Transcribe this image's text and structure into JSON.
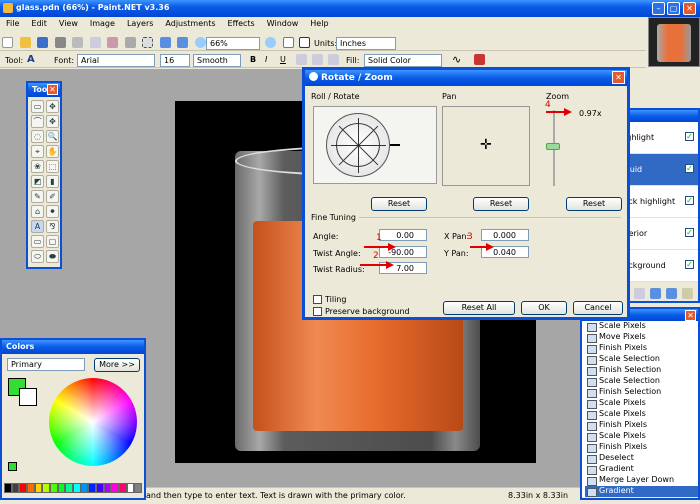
{
  "app": {
    "title": "glass.pdn (66%) - Paint.NET v3.36"
  },
  "menu": [
    "File",
    "Edit",
    "View",
    "Image",
    "Layers",
    "Adjustments",
    "Effects",
    "Window",
    "Help"
  ],
  "toolbar1": {
    "zoom": "66%",
    "units_label": "Units:",
    "units_value": "Inches"
  },
  "toolbar2": {
    "tool_label": "Tool:",
    "tool_value": "A",
    "font_label": "Font:",
    "font_value": "Arial",
    "size_value": "16",
    "smooth_value": "Smooth",
    "bold": "B",
    "italic": "I",
    "underline": "U",
    "fill_label": "Fill:",
    "fill_value": "Solid Color"
  },
  "tools": {
    "title": "Tools",
    "glyphs": [
      "▭",
      "✥",
      "⌒",
      "✥",
      "◌",
      "🔍",
      "⌖",
      "✋",
      "❀",
      "⬚",
      "◩",
      "▮",
      "✎",
      "✐",
      "⌂",
      "⚫",
      "A",
      "⅋",
      "▭",
      "▢",
      "⬭",
      "⬬"
    ]
  },
  "colors": {
    "title": "Colors",
    "select": "Primary",
    "more": "More >>",
    "primary": "#33dd33",
    "palette": [
      "#000000",
      "#404040",
      "#ff0000",
      "#ff6a00",
      "#ffd800",
      "#b6ff00",
      "#4cff00",
      "#00ff21",
      "#00ff90",
      "#00ffff",
      "#0094ff",
      "#0026ff",
      "#4800ff",
      "#b200ff",
      "#ff00dc",
      "#ff006e",
      "#ffffff",
      "#808080"
    ]
  },
  "layers": {
    "items": [
      "Highlight",
      "Liquid",
      "Back highlight",
      "Interior",
      "Background"
    ],
    "selected": 1
  },
  "history": {
    "items": [
      "Scale Pixels",
      "Move Pixels",
      "Finish Pixels",
      "Scale Selection",
      "Finish Selection",
      "Scale Selection",
      "Finish Selection",
      "Scale Pixels",
      "Scale Pixels",
      "Finish Pixels",
      "Scale Pixels",
      "Finish Pixels",
      "Deselect",
      "Gradient",
      "Merge Layer Down",
      "Gradient"
    ],
    "selected": 15
  },
  "status": {
    "hint": "and then type to enter text. Text is drawn with the primary color.",
    "size": "8.33in x 8.33in"
  },
  "dialog": {
    "title": "Rotate / Zoom",
    "roll_label": "Roll / Rotate",
    "pan_label": "Pan",
    "zoom_label": "Zoom",
    "zoom_value": "0.97x",
    "reset": "Reset",
    "fine_tuning": "Fine Tuning",
    "angle_label": "Angle:",
    "angle_value": "0.00",
    "twist_angle_label": "Twist Angle:",
    "twist_angle_value": "-90.00",
    "twist_radius_label": "Twist Radius:",
    "twist_radius_value": "7.00",
    "xpan_label": "X Pan:",
    "xpan_value": "0.000",
    "ypan_label": "Y Pan:",
    "ypan_value": "0.040",
    "tiling": "Tiling",
    "preserve": "Preserve background",
    "reset_all": "Reset All",
    "ok": "OK",
    "cancel": "Cancel"
  },
  "annotations": {
    "a1": "1",
    "a2": "2",
    "a3": "3",
    "a4": "4"
  }
}
